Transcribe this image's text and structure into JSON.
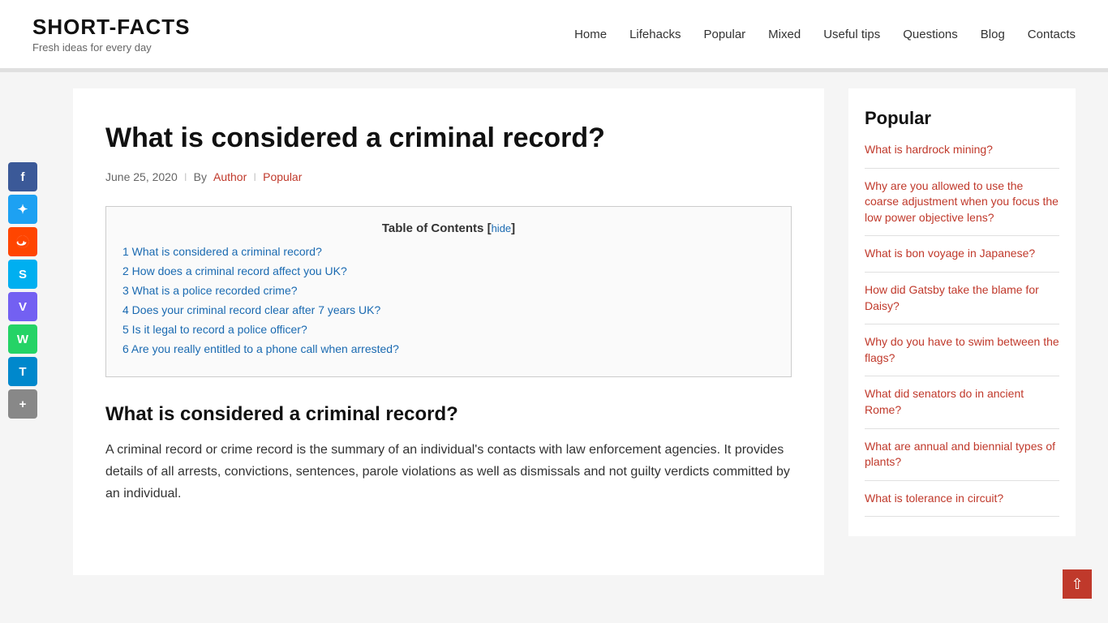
{
  "site": {
    "title": "SHORT-FACTS",
    "tagline": "Fresh ideas for every day"
  },
  "nav": {
    "items": [
      {
        "label": "Home"
      },
      {
        "label": "Lifehacks"
      },
      {
        "label": "Popular"
      },
      {
        "label": "Mixed"
      },
      {
        "label": "Useful tips"
      },
      {
        "label": "Questions"
      },
      {
        "label": "Blog"
      },
      {
        "label": "Contacts"
      }
    ]
  },
  "social": {
    "buttons": [
      {
        "name": "facebook",
        "label": "f",
        "class": "facebook"
      },
      {
        "name": "twitter",
        "label": "t",
        "class": "twitter"
      },
      {
        "name": "reddit",
        "label": "r",
        "class": "reddit"
      },
      {
        "name": "skype",
        "label": "S",
        "class": "skype"
      },
      {
        "name": "viber",
        "label": "V",
        "class": "viber"
      },
      {
        "name": "whatsapp",
        "label": "W",
        "class": "whatsapp"
      },
      {
        "name": "telegram",
        "label": "T",
        "class": "telegram"
      },
      {
        "name": "share",
        "label": "+",
        "class": "share"
      }
    ]
  },
  "article": {
    "title": "What is considered a criminal record?",
    "date": "June 25, 2020",
    "author": "Author",
    "category": "Popular",
    "toc": {
      "heading": "Table of Contents",
      "hide_label": "hide",
      "items": [
        {
          "num": "1",
          "text": "What is considered a criminal record?"
        },
        {
          "num": "2",
          "text": "How does a criminal record affect you UK?"
        },
        {
          "num": "3",
          "text": "What is a police recorded crime?"
        },
        {
          "num": "4",
          "text": "Does your criminal record clear after 7 years UK?"
        },
        {
          "num": "5",
          "text": "Is it legal to record a police officer?"
        },
        {
          "num": "6",
          "text": "Are you really entitled to a phone call when arrested?"
        }
      ]
    },
    "section1_title": "What is considered a criminal record?",
    "section1_body": "A criminal record or crime record is the summary of an individual's contacts with law enforcement agencies. It provides details of all arrests, convictions, sentences, parole violations as well as dismissals and not guilty verdicts committed by an individual."
  },
  "sidebar": {
    "popular_heading": "Popular",
    "items": [
      {
        "label": "What is hardrock mining?"
      },
      {
        "label": "Why are you allowed to use the coarse adjustment when you focus the low power objective lens?"
      },
      {
        "label": "What is bon voyage in Japanese?"
      },
      {
        "label": "How did Gatsby take the blame for Daisy?"
      },
      {
        "label": "Why do you have to swim between the flags?"
      },
      {
        "label": "What did senators do in ancient Rome?"
      },
      {
        "label": "What are annual and biennial types of plants?"
      },
      {
        "label": "What is tolerance in circuit?"
      }
    ]
  }
}
